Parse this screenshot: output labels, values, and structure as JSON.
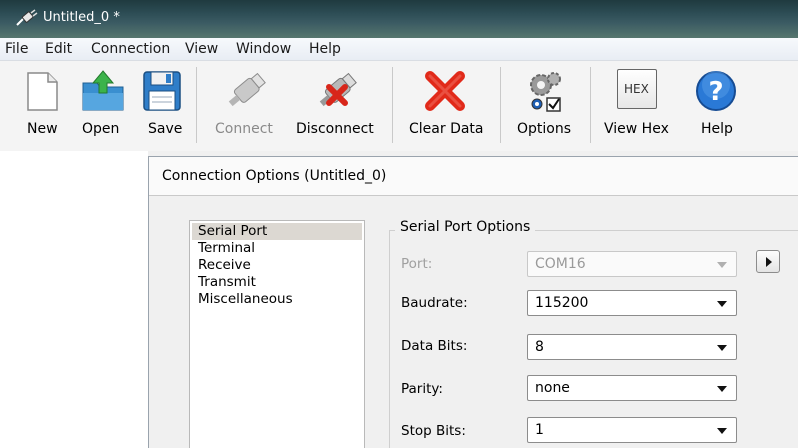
{
  "window": {
    "title": "Untitled_0 *"
  },
  "menu": [
    "File",
    "Edit",
    "Connection",
    "View",
    "Window",
    "Help"
  ],
  "toolbar": {
    "new": "New",
    "open": "Open",
    "save": "Save",
    "connect": "Connect",
    "disconnect": "Disconnect",
    "clear_data": "Clear Data",
    "options": "Options",
    "view_hex": "View Hex",
    "hex_icon_text": "HEX",
    "help": "Help"
  },
  "dialog": {
    "title": "Connection Options (Untitled_0)",
    "categories": [
      "Serial Port",
      "Terminal",
      "Receive",
      "Transmit",
      "Miscellaneous"
    ],
    "selected_category": "Serial Port",
    "group_title": "Serial Port Options",
    "fields": {
      "port": {
        "label": "Port:",
        "value": "COM16",
        "disabled": true
      },
      "baudrate": {
        "label": "Baudrate:",
        "value": "115200"
      },
      "data_bits": {
        "label": "Data Bits:",
        "value": "8"
      },
      "parity": {
        "label": "Parity:",
        "value": "none"
      },
      "stop_bits": {
        "label": "Stop Bits:",
        "value": "1"
      }
    }
  },
  "icons": {
    "app": "plug-icon",
    "new": "new-document-icon",
    "open": "open-folder-icon",
    "save": "floppy-disk-icon",
    "connect": "usb-plug-icon",
    "disconnect": "usb-disconnect-icon",
    "clear": "red-x-icon",
    "options": "gears-checkbox-icon",
    "hex": "hex-icon",
    "help": "help-question-icon"
  },
  "colors": {
    "accent_blue": "#2a79d6",
    "clear_red": "#e12a1a",
    "selected_bg": "#dcd8d2"
  }
}
